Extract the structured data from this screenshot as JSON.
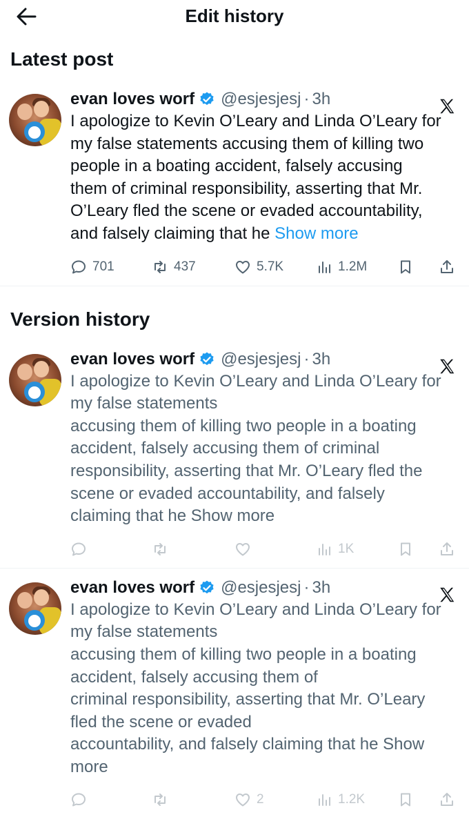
{
  "header": {
    "title": "Edit history"
  },
  "sections": {
    "latest": "Latest post",
    "versions": "Version history"
  },
  "posts": [
    {
      "name": "evan loves worf",
      "handle": "@esjesjesj",
      "time": "3h",
      "lines": [
        "I apologize to Kevin O’Leary and Linda O’Leary for",
        "my false statements accusing them of killing two",
        "people in a boating accident, falsely accusing",
        "them of criminal responsibility, asserting that Mr.",
        "O’Leary fled the scene or evaded accountability,",
        "and falsely claiming that he"
      ],
      "show_more": "Show more",
      "stats": {
        "replies": "701",
        "reposts": "437",
        "likes": "5.7K",
        "views": "1.2M"
      }
    },
    {
      "name": "evan loves worf",
      "handle": "@esjesjesj",
      "time": "3h",
      "lines": [
        "I apologize to Kevin O’Leary and Linda O’Leary for",
        "my false statements",
        "accusing them of killing two people in a boating",
        "accident, falsely accusing them of criminal",
        "responsibility, asserting that Mr. O’Leary fled the",
        "scene or evaded accountability, and falsely",
        "claiming that he"
      ],
      "show_more": "Show more",
      "stats": {
        "views": "1K"
      }
    },
    {
      "name": "evan loves worf",
      "handle": "@esjesjesj",
      "time": "3h",
      "lines": [
        "I apologize to Kevin O’Leary and Linda O’Leary for",
        "my false statements",
        "accusing them of killing two people in a boating",
        "accident, falsely accusing them of",
        "criminal responsibility, asserting that Mr. O’Leary",
        "fled the scene or evaded",
        "accountability, and falsely claiming that he"
      ],
      "show_more": "Show",
      "show_more_2": "more",
      "stats": {
        "likes": "2",
        "views": "1.2K"
      }
    }
  ],
  "icons": {
    "back": "arrow-left-icon",
    "verified": "verified-badge-icon",
    "platform": "x-logo-icon",
    "reply": "reply-icon",
    "repost": "repost-icon",
    "like": "heart-icon",
    "views": "views-icon",
    "bookmark": "bookmark-icon",
    "share": "share-icon"
  },
  "colors": {
    "accent": "#1d9bf0",
    "text": "#0f1419",
    "muted": "#536471",
    "divider": "#eff3f4"
  }
}
